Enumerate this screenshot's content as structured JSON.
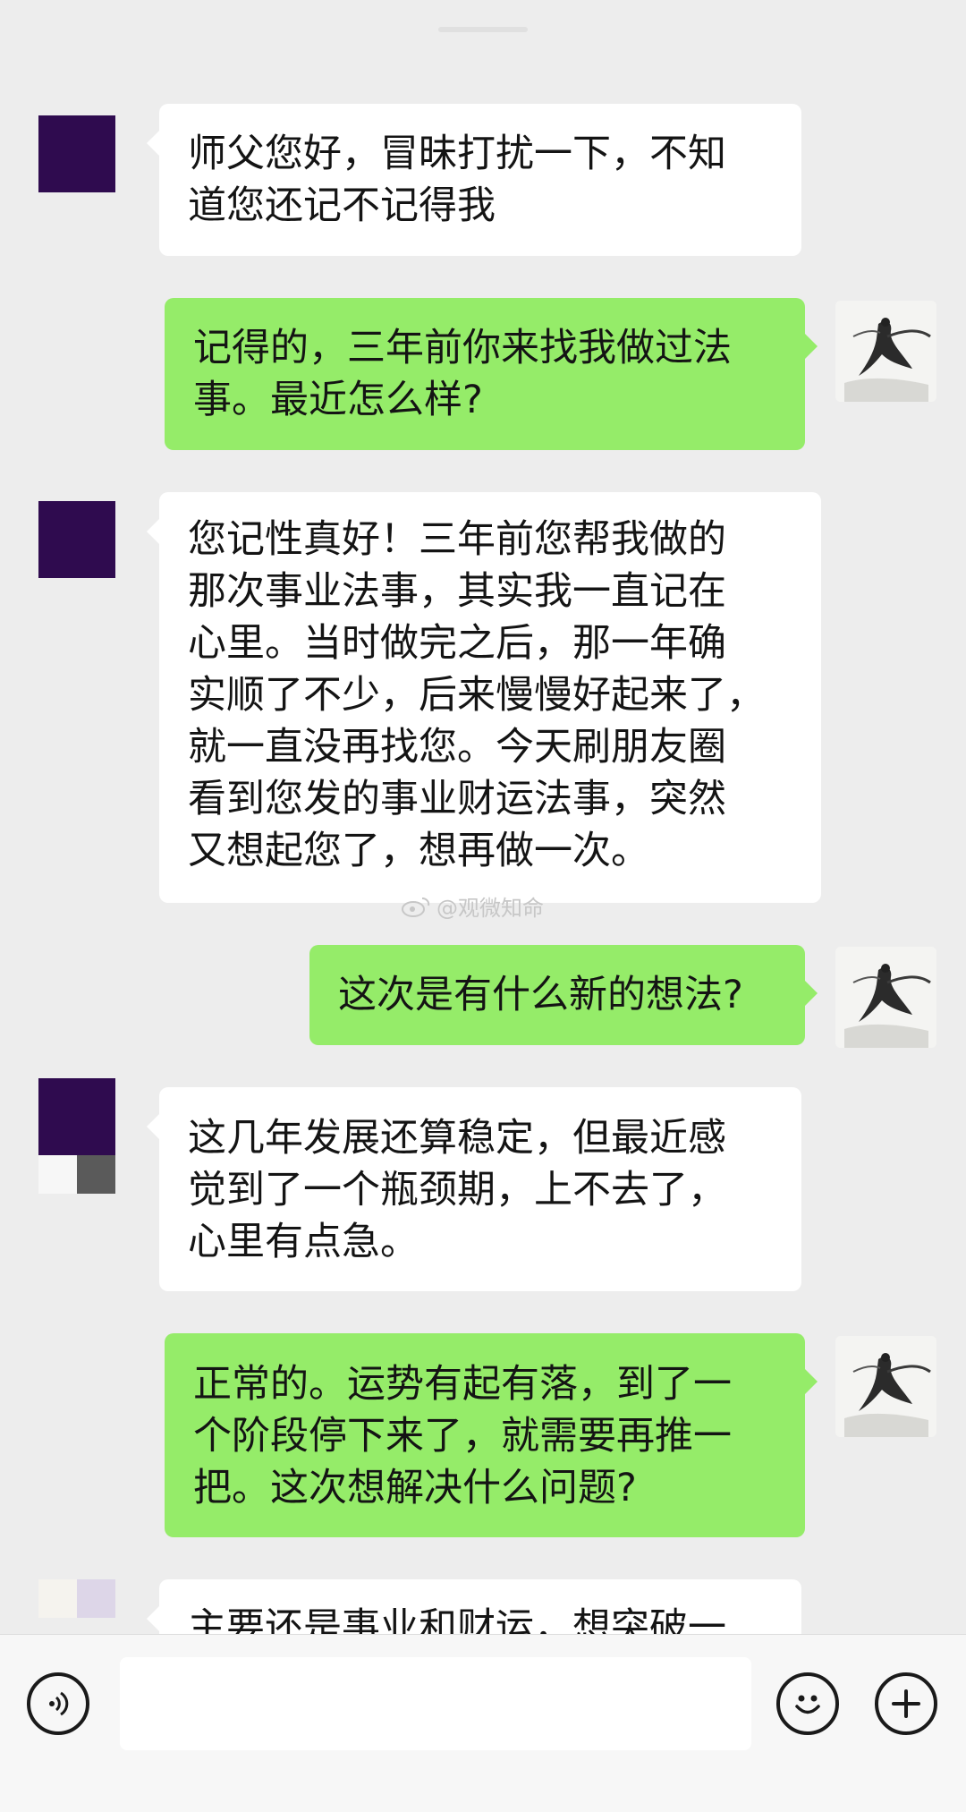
{
  "chat": {
    "messages": [
      {
        "side": "left",
        "text": "师父您好，冒昧打扰一下，不知\n道您还记不记得我"
      },
      {
        "side": "right",
        "text": "记得的，三年前你来找我做过法\n事。最近怎么样?"
      },
      {
        "side": "left",
        "text": "您记性真好！三年前您帮我做的\n那次事业法事，其实我一直记在\n心里。当时做完之后，那一年确\n实顺了不少，后来慢慢好起来了，\n就一直没再找您。今天刷朋友圈\n看到您发的事业财运法事，突然\n又想起您了，想再做一次。"
      },
      {
        "side": "right",
        "text": "这次是有什么新的想法?"
      },
      {
        "side": "left",
        "text": "这几年发展还算稳定，但最近感\n觉到了一个瓶颈期，上不去了，\n心里有点急。"
      },
      {
        "side": "right",
        "text": "正常的。运势有起有落，到了一\n个阶段停下来了，就需要再推一\n把。这次想解决什么问题?"
      },
      {
        "side": "left",
        "text": "主要还是事业和财运，想突破一"
      }
    ],
    "watermark": "@观微知命"
  },
  "input_bar": {
    "input_value": "",
    "voice_icon": "voice-icon",
    "emoji_icon": "emoji-icon",
    "plus_icon": "plus-icon"
  },
  "colors": {
    "background": "#ededed",
    "bubble_sent": "#95ec69",
    "bubble_received": "#ffffff",
    "contact_avatar": "#2f0b4f"
  }
}
